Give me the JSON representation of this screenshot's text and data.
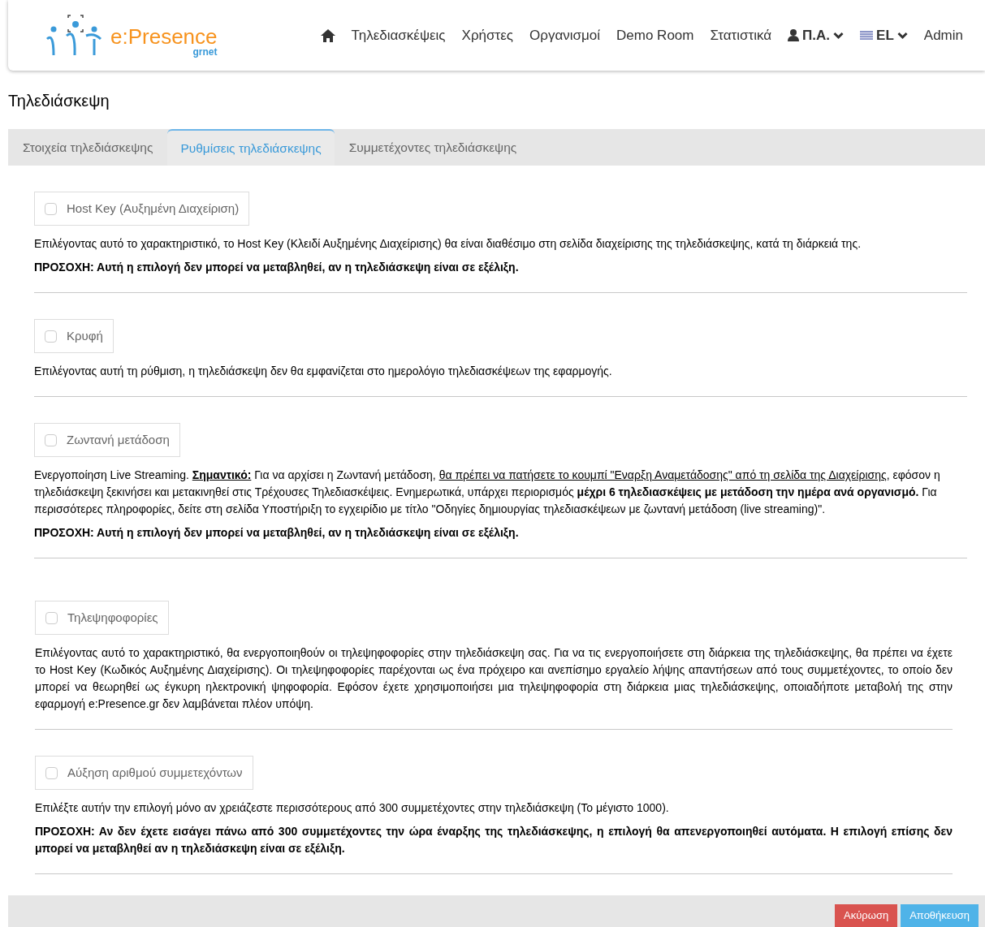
{
  "header": {
    "logo_text": "e:Presence",
    "logo_sub": "grnet",
    "nav": [
      {
        "kind": "home"
      },
      {
        "kind": "link",
        "label": "Τηλεδιασκέψεις"
      },
      {
        "kind": "link",
        "label": "Χρήστες"
      },
      {
        "kind": "link",
        "label": "Οργανισμοί"
      },
      {
        "kind": "link",
        "label": "Demo Room"
      },
      {
        "kind": "link",
        "label": "Στατιστικά"
      },
      {
        "kind": "user",
        "label": "Π.Α."
      },
      {
        "kind": "lang",
        "label": "EL"
      },
      {
        "kind": "link",
        "label": "Admin"
      }
    ]
  },
  "page_title": "Τηλεδιάσκεψη",
  "tabs": [
    {
      "label": "Στοιχεία τηλεδιάσκεψης",
      "selected": false
    },
    {
      "label": "Ρυθμίσεις τηλεδιάσκεψης",
      "selected": true
    },
    {
      "label": "Συμμετέχοντες τηλεδιάσκεψης",
      "selected": false
    }
  ],
  "groups": [
    {
      "sections": [
        {
          "label": "Host Key (Αυξημένη Διαχείριση)",
          "checked": false,
          "paragraphs": [
            [
              {
                "kind": "text",
                "text": "Επιλέγοντας αυτό το χαρακτηριστικό, το Host Key (Κλειδί Αυξημένης Διαχείρισης) θα είναι διαθέσιμο στη σελίδα διαχείρισης της τηλεδιάσκεψης, κατά τη διάρκειά της."
              }
            ],
            [
              {
                "kind": "bold",
                "text": "ΠΡΟΣΟΧΗ: Αυτή η επιλογή δεν μπορεί να μεταβληθεί, αν η τηλεδιάσκεψη είναι σε εξέλιξη."
              }
            ]
          ]
        },
        {
          "label": "Κρυφή",
          "checked": false,
          "paragraphs": [
            [
              {
                "kind": "text",
                "text": "Επιλέγοντας αυτή τη ρύθμιση, η τηλεδιάσκεψη δεν θα εμφανίζεται στο ημερολόγιο τηλεδιασκέψεων της εφαρμογής."
              }
            ]
          ]
        },
        {
          "label": "Ζωντανή μετάδοση",
          "checked": false,
          "paragraphs": [
            [
              {
                "kind": "text",
                "text": "Ενεργοποίηση Live Streaming. "
              },
              {
                "kind": "bold_underline",
                "text": "Σημαντικό:"
              },
              {
                "kind": "text",
                "text": " Για να αρχίσει η Ζωντανή μετάδοση, "
              },
              {
                "kind": "link",
                "text": "θα πρέπει να πατήσετε το κουμπί \"Εναρξη Αναμετάδοσης\" από τη σελίδα της Διαχείρισης"
              },
              {
                "kind": "text",
                "text": ", εφόσον η τηλεδιάσκεψη ξεκινήσει και μετακινηθεί στις Τρέχουσες Τηλεδιασκέψεις. Ενημερωτικά, υπάρχει περιορισμός "
              },
              {
                "kind": "bold",
                "text": "μέχρι 6 τηλεδιασκέψεις με μετάδοση την ημέρα ανά οργανισμό."
              },
              {
                "kind": "text",
                "text": " Για περισσότερες πληροφορίες, δείτε στη σελίδα Υποστήριξη το εγχειρίδιο με τίτλο \"Οδηγίες δημιουργίας τηλεδιασκέψεων με ζωντανή μετάδοση (live streaming)\"."
              }
            ],
            [
              {
                "kind": "bold",
                "text": "ΠΡΟΣΟΧΗ: Αυτή η επιλογή δεν μπορεί να μεταβληθεί, αν η τηλεδιάσκεψη είναι σε εξέλιξη."
              }
            ]
          ]
        }
      ]
    },
    {
      "sections": [
        {
          "label": "Τηλεψηφοφορίες",
          "checked": false,
          "paragraphs": [
            [
              {
                "kind": "text",
                "text": "Επιλέγοντας αυτό το χαρακτηριστικό, θα ενεργοποιηθούν οι τηλεψηφοφορίες στην τηλεδιάσκεψη σας. Για να τις ενεργοποιήσετε στη διάρκεια της τηλεδιάσκεψης, θα πρέπει να έχετε το Host Key (Κωδικός Αυξημένης Διαχείρισης). Οι τηλεψηφοφορίες παρέχονται ως ένα πρόχειρο και ανεπίσημο εργαλείο λήψης απαντήσεων από τους συμμετέχοντες, το οποίο δεν μπορεί να θεωρηθεί ως έγκυρη ηλεκτρονική ψηφοφορία. Εφόσον έχετε χρησιμοποιήσει μια τηλεψηφοφορία στη διάρκεια μιας τηλεδιάσκεψης, οποιαδήποτε μεταβολή της στην εφαρμογή e:Presence.gr δεν λαμβάνεται πλέον υπόψη."
              }
            ]
          ]
        },
        {
          "label": "Αύξηση αριθμού συμμετεχόντων",
          "checked": false,
          "paragraphs": [
            [
              {
                "kind": "text",
                "text": "Επιλέξτε αυτήν την επιλογή μόνο αν χρειάζεστε περισσότερους από 300 συμμετέχοντες στην τηλεδιάσκεψη (Το μέγιστο 1000)."
              }
            ],
            [
              {
                "kind": "bold",
                "text": "ΠΡΟΣΟΧΗ: Αν δεν έχετε εισάγει πάνω από 300 συμμετέχοντες την ώρα έναρξης της τηλεδιάσκεψης, η επιλογή θα απενεργοποιηθεί αυτόματα. Η επιλογή επίσης δεν μπορεί να μεταβληθεί αν η τηλεδιάσκεψη είναι σε εξέλιξη."
              }
            ]
          ]
        }
      ]
    }
  ],
  "buttons": [
    {
      "kind": "cancel",
      "label": "Ακύρωση"
    },
    {
      "kind": "save",
      "label": "Αποθήκευση"
    }
  ]
}
